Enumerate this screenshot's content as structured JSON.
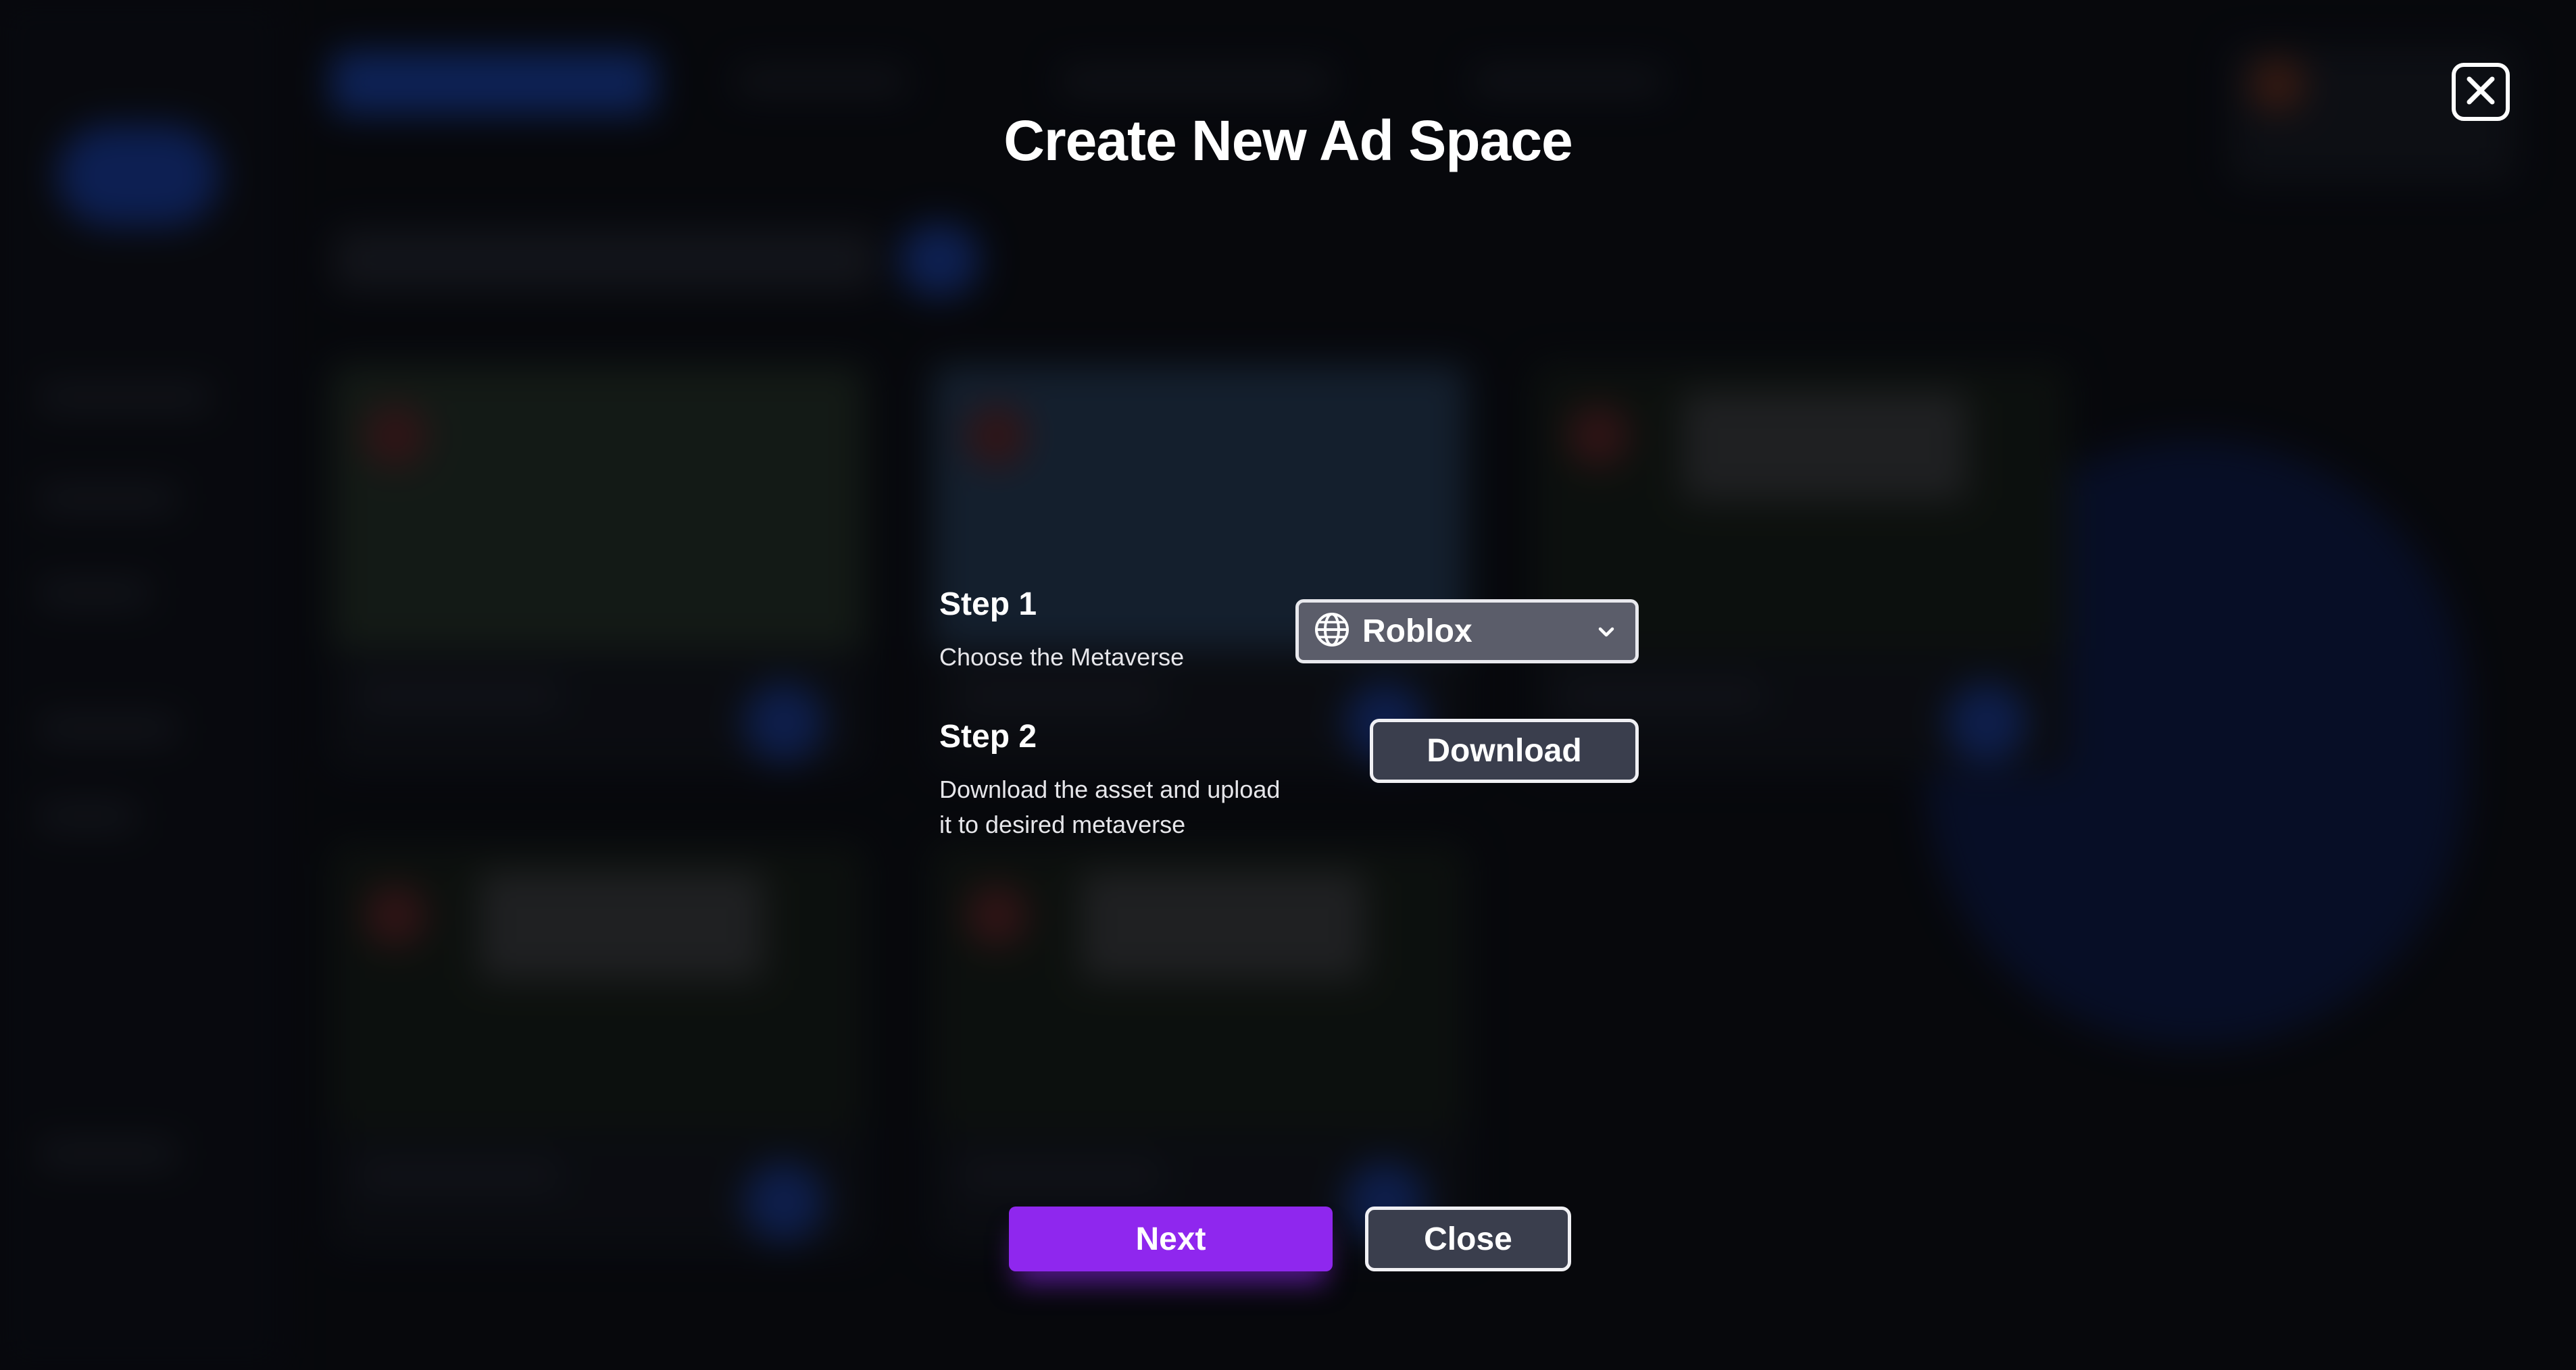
{
  "modal": {
    "title": "Create New Ad Space",
    "step1": {
      "title": "Step 1",
      "description": "Choose the Metaverse",
      "select_value": "Roblox"
    },
    "step2": {
      "title": "Step 2",
      "description_line1": "Download the asset and upload",
      "description_line2": "it to desired metaverse",
      "download_label": "Download"
    },
    "next_label": "Next",
    "close_label": "Close"
  },
  "colors": {
    "primary_purple": "#8f27ee",
    "button_fill": "#3a3e4d",
    "select_fill": "#5b5d6a",
    "overlay": "#05060a"
  },
  "icons": {
    "close": "close-x-icon",
    "globe": "globe-icon",
    "chevron": "chevron-down-icon"
  }
}
